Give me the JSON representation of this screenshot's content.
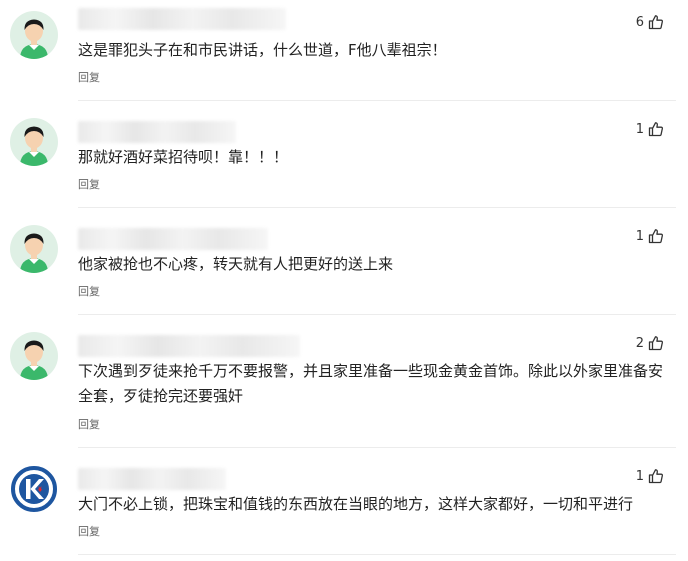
{
  "comments": [
    {
      "avatar": "cartoon-avatar",
      "likes": "6",
      "content": "这是罪犯头子在和市民讲话，什么世道，F他八辈祖宗！",
      "reply": "回复"
    },
    {
      "avatar": "cartoon-avatar",
      "likes": "1",
      "content": "那就好酒好菜招待呗！靠！！！",
      "reply": "回复"
    },
    {
      "avatar": "cartoon-avatar",
      "likes": "1",
      "content": "他家被抢也不心疼，转天就有人把更好的送上来",
      "reply": "回复"
    },
    {
      "avatar": "cartoon-avatar",
      "likes": "2",
      "content": "下次遇到歹徒来抢千万不要报警，并且家里准备一些现金黄金首饰。除此以外家里准备安全套，歹徒抢完还要强奸",
      "reply": "回复"
    },
    {
      "avatar": "brand-logo-avatar",
      "likes": "1",
      "content": "大门不必上锁，把珠宝和值钱的东西放在当眼的地方，这样大家都好，一切和平进行",
      "reply": "回复"
    }
  ],
  "colors": {
    "avatar_bg": "#dff0e5",
    "shirt_green": "#3bb86b",
    "hair": "#1a1a1a",
    "brand_blue": "#1e56a0",
    "brand_red": "#e0262c"
  },
  "icons": {
    "like": "thumbs-up-icon"
  }
}
